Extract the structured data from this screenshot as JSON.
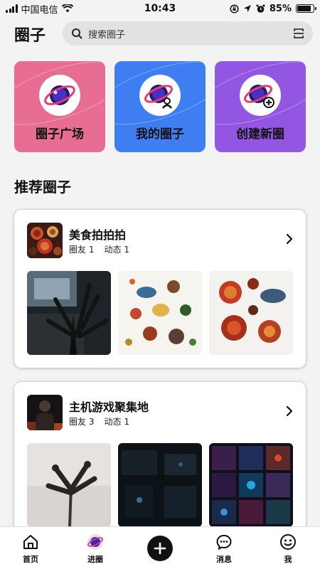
{
  "status_bar": {
    "carrier": "中国电信",
    "time": "10:43",
    "battery_percent": "85%",
    "battery_level": 0.85
  },
  "header": {
    "title": "圈子",
    "search_placeholder": "搜索圈子"
  },
  "tiles": [
    {
      "label": "圈子广场",
      "icon": "planet-icon",
      "color": "#e76d92"
    },
    {
      "label": "我的圈子",
      "icon": "planet-user-icon",
      "color": "#3f7ef2"
    },
    {
      "label": "创建新圈",
      "icon": "planet-add-icon",
      "color": "#9256e3"
    }
  ],
  "section_title": "推荐圈子",
  "circles": [
    {
      "name": "美食拍拍拍",
      "members_label": "圈友",
      "members": "1",
      "posts_label": "动态",
      "posts": "1"
    },
    {
      "name": "主机游戏聚集地",
      "members_label": "圈友",
      "members": "3",
      "posts_label": "动态",
      "posts": "1"
    }
  ],
  "bottom_nav": [
    {
      "label": "首页",
      "icon": "home-icon"
    },
    {
      "label": "进圈",
      "icon": "planet-icon"
    },
    {
      "label": "",
      "icon": "plus-icon"
    },
    {
      "label": "消息",
      "icon": "chat-bubble-icon"
    },
    {
      "label": "我",
      "icon": "smiley-icon"
    }
  ]
}
